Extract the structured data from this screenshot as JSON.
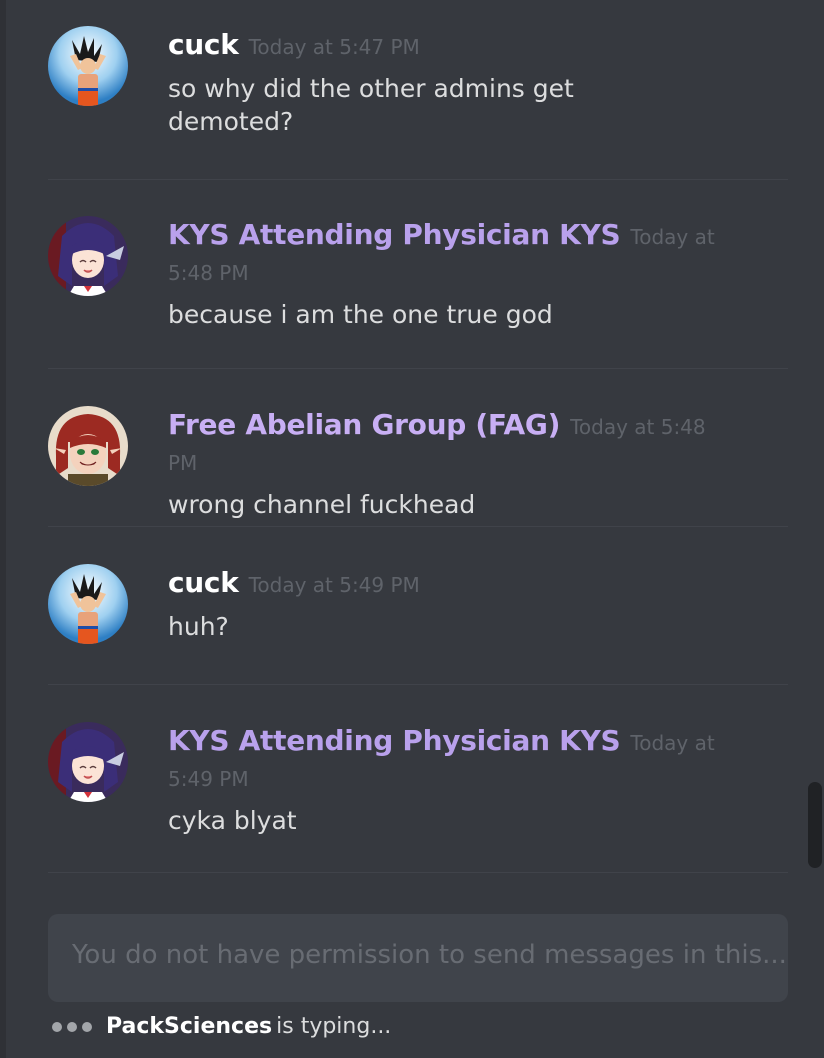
{
  "messages": [
    {
      "username": "cuck",
      "timestamp": "Today at 5:47 PM",
      "content": "so why did the other admins get demoted?",
      "avatar": "goku-avatar",
      "name_color": "#ffffff"
    },
    {
      "username": "KYS Attending Physician KYS",
      "timestamp": "Today at 5:48 PM",
      "content": "because i am the one true god",
      "avatar": "anime-girl-avatar",
      "name_color": "#b9a1ec"
    },
    {
      "username": "Free Abelian Group (FAG)",
      "timestamp": "Today at 5:48 PM",
      "content": "wrong channel fuckhead",
      "avatar": "redhead-avatar",
      "name_color": "#c8aff4"
    },
    {
      "username": "cuck",
      "timestamp": "Today at 5:49 PM",
      "content": "huh?",
      "avatar": "goku-avatar",
      "name_color": "#ffffff"
    },
    {
      "username": "KYS Attending Physician KYS",
      "timestamp": "Today at 5:49 PM",
      "content": "cyka blyat",
      "avatar": "anime-girl-avatar",
      "name_color": "#b9a1ec"
    }
  ],
  "input": {
    "placeholder": "You do not have permission to send messages in this..."
  },
  "typing": {
    "name": "PackSciences",
    "suffix": "is typing..."
  },
  "colors": {
    "background": "#36393f",
    "input_background": "#40444b",
    "timestamp": "#5f636a"
  }
}
